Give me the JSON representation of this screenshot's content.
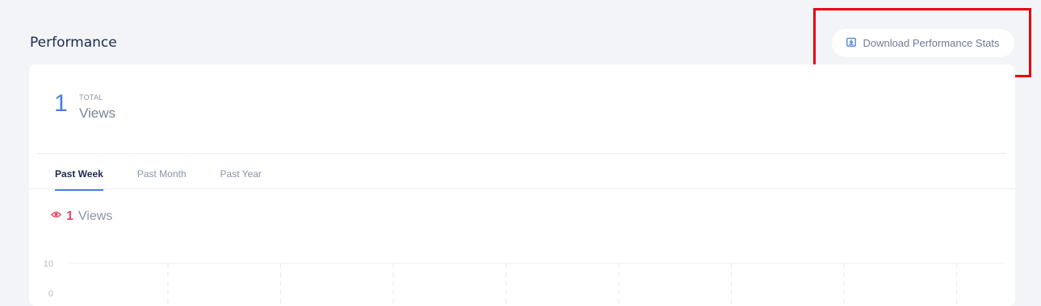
{
  "header": {
    "title": "Performance",
    "download_label": "Download Performance Stats",
    "download_icon": "download-icon"
  },
  "summary": {
    "total_value": "1",
    "total_caption": "TOTAL",
    "total_unit": "Views"
  },
  "tabs": [
    {
      "label": "Past Week",
      "active": true
    },
    {
      "label": "Past Month",
      "active": false
    },
    {
      "label": "Past Year",
      "active": false
    }
  ],
  "views_summary": {
    "icon": "eye-icon",
    "count": "1",
    "unit": "Views"
  },
  "chart": {
    "y_ticks": [
      "10",
      "0"
    ],
    "vertical_gridlines": 8
  },
  "colors": {
    "accent": "#4a7ee0",
    "views_accent": "#e9486b",
    "highlight": "#e8000d"
  }
}
